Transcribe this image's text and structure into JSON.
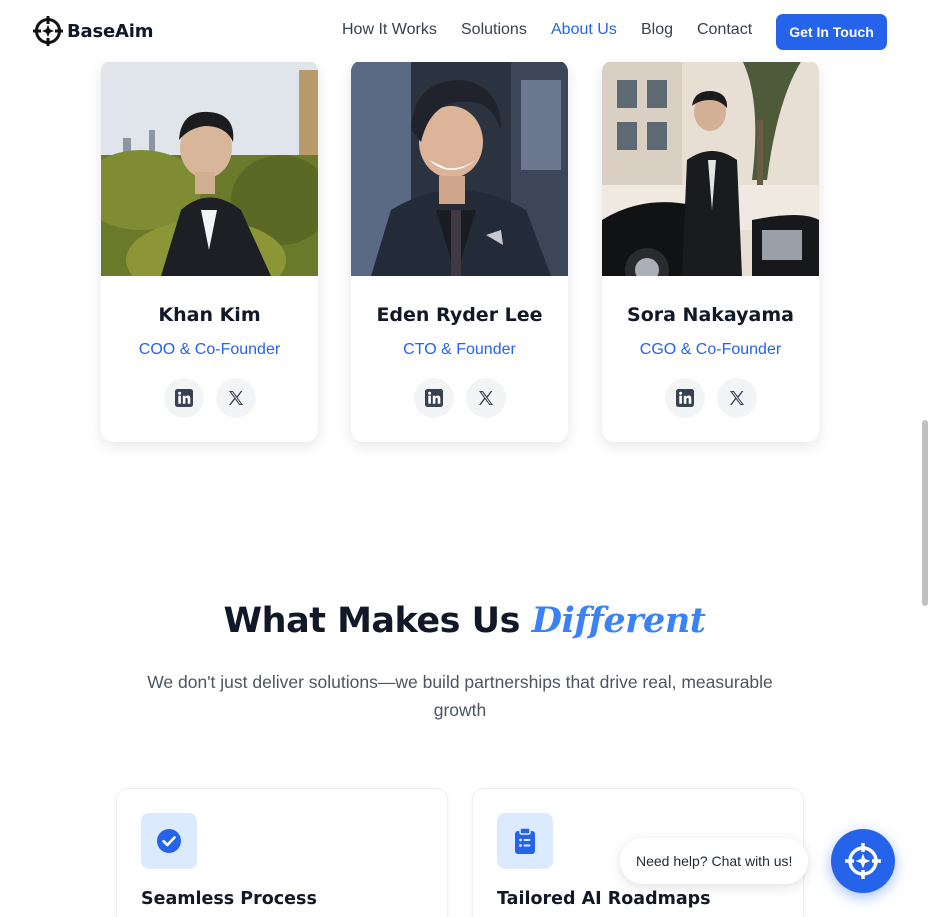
{
  "header": {
    "brand": "BaseAim",
    "nav": [
      "How It Works",
      "Solutions",
      "About Us",
      "Blog",
      "Contact"
    ],
    "active_nav": "About Us",
    "cta_label": "Get In Touch"
  },
  "team": [
    {
      "name": "Khan Kim",
      "role": "COO & Co-Founder"
    },
    {
      "name": "Eden Ryder Lee",
      "role": "CTO & Founder"
    },
    {
      "name": "Sora Nakayama",
      "role": "CGO & Co-Founder"
    }
  ],
  "section": {
    "title_main": "What Makes Us",
    "title_accent": "Different",
    "subtitle": "We don't just deliver solutions—we build partnerships that drive real, measurable growth"
  },
  "features": [
    {
      "title": "Seamless Process",
      "icon": "check-circle-icon"
    },
    {
      "title": "Tailored AI Roadmaps",
      "icon": "clipboard-list-icon"
    }
  ],
  "chat": {
    "prompt": "Need help? Chat with us!",
    "icon": "crosshair-icon"
  },
  "colors": {
    "accent": "#2563eb",
    "accent_light": "#3b82f6",
    "icon_bg": "#dbeafe"
  }
}
